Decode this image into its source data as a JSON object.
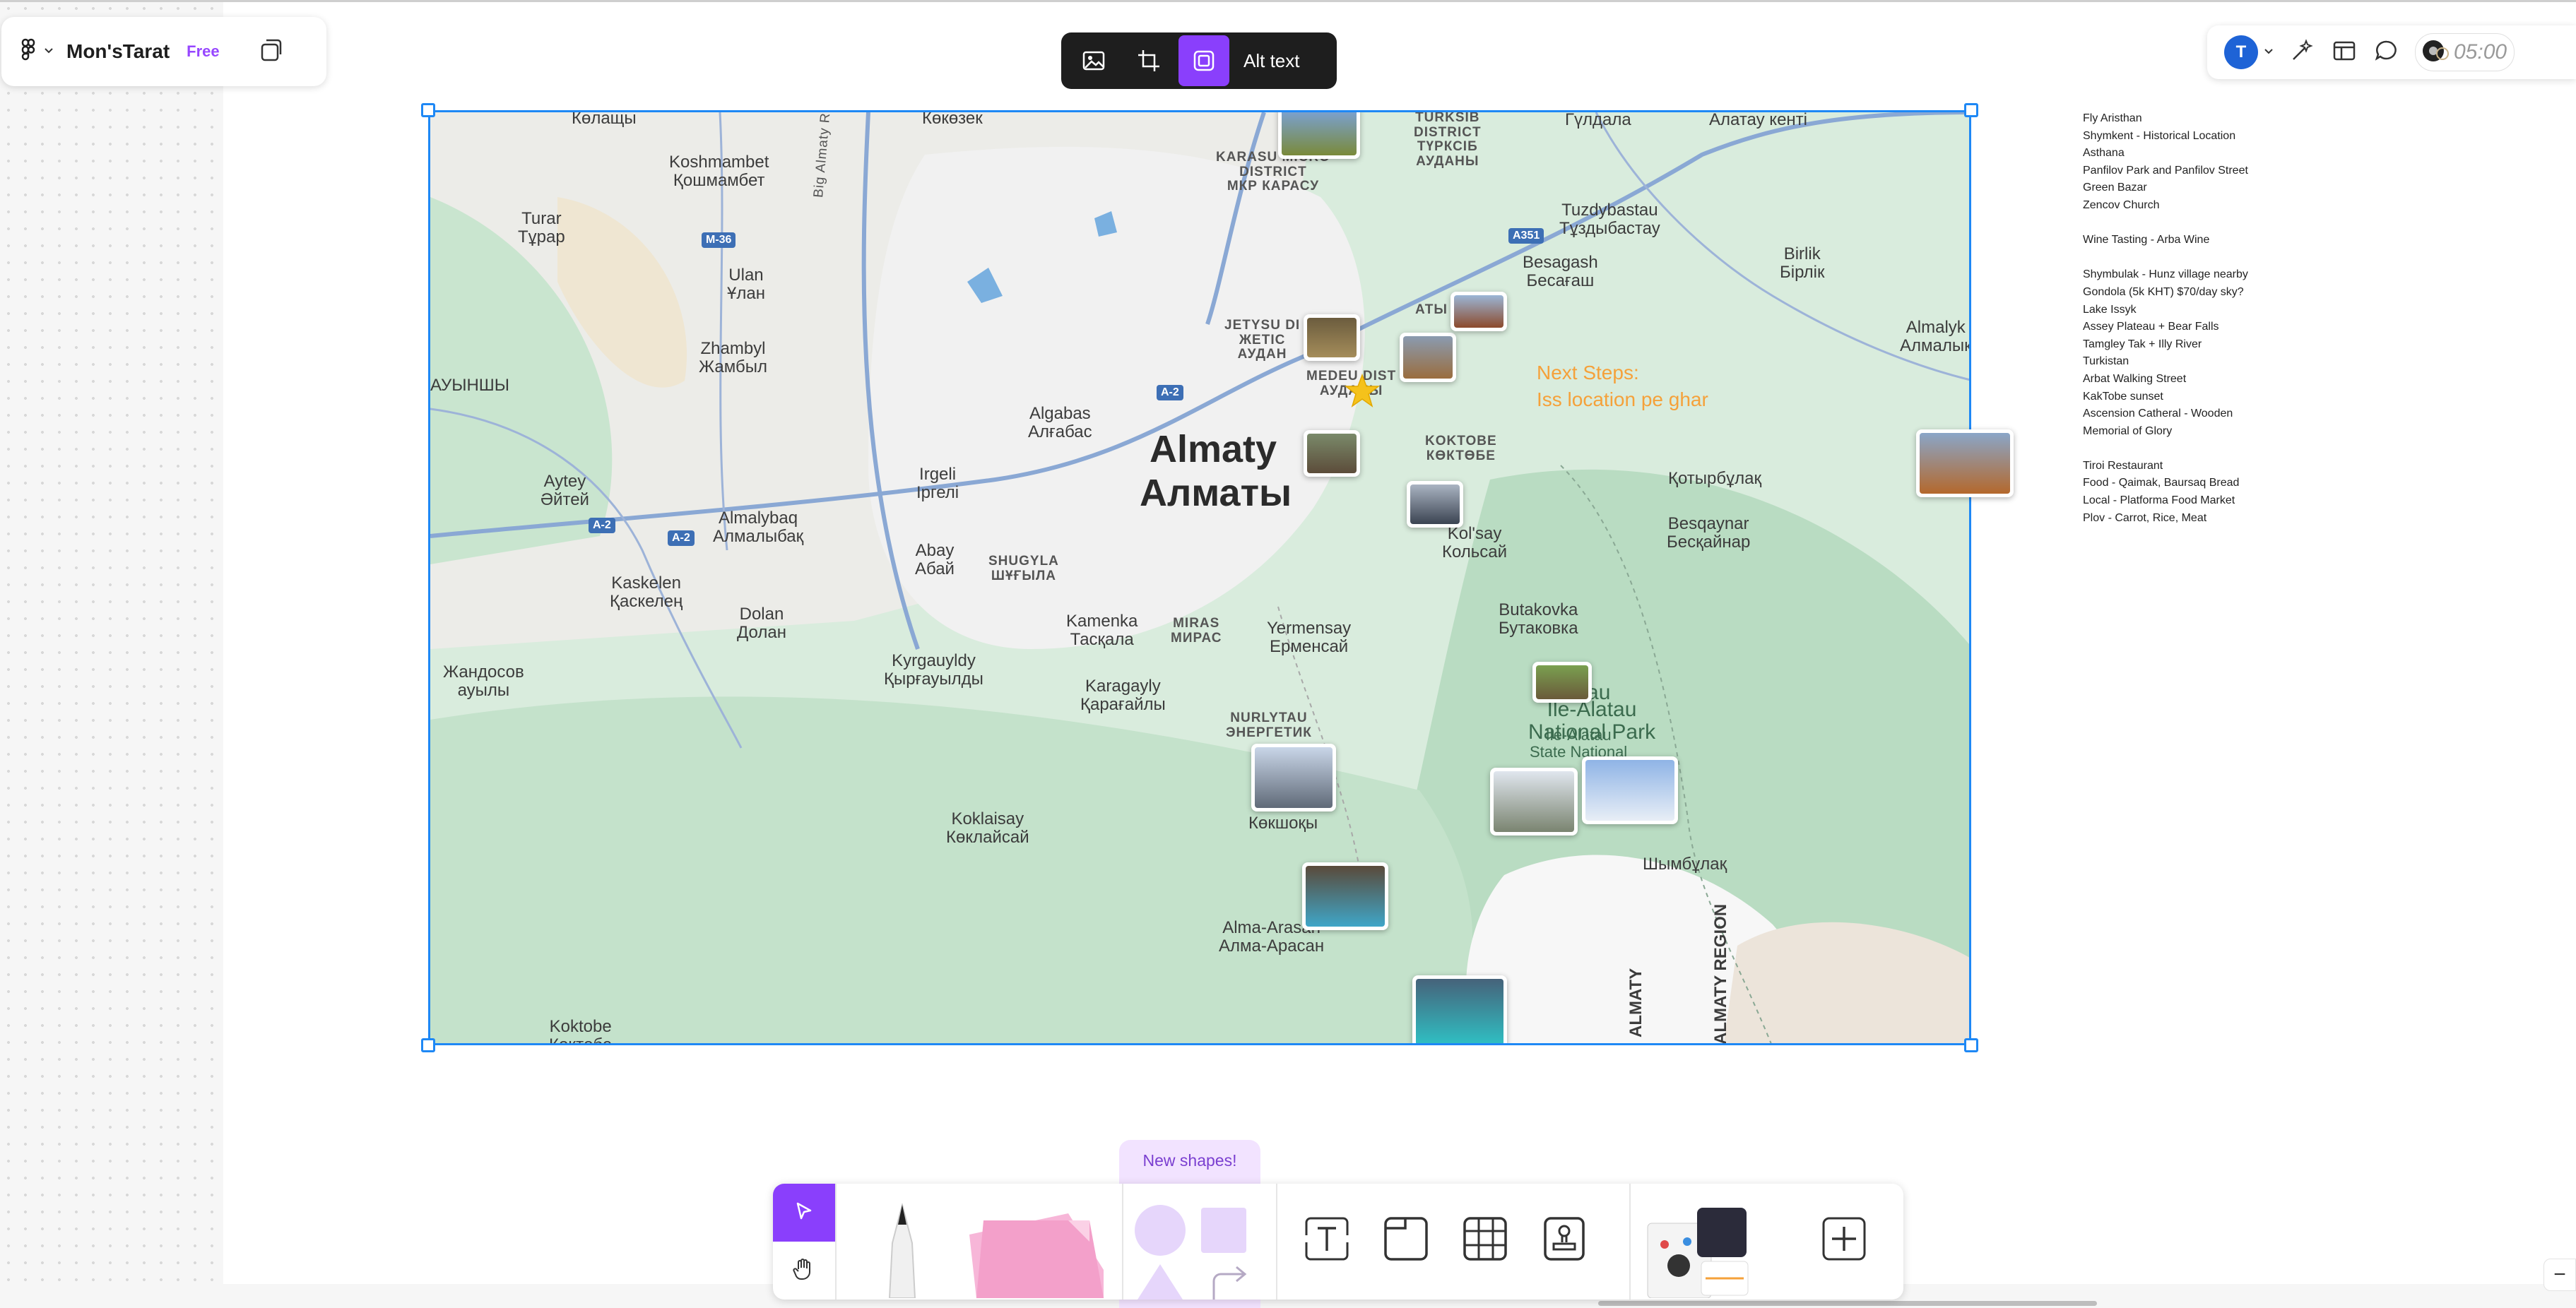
{
  "file": {
    "name": "Mon'sTarat",
    "plan": "Free"
  },
  "image_toolbar": {
    "alt_text_label": "Alt text"
  },
  "right_toolbar": {
    "avatar_initial": "T",
    "timer": "05:00"
  },
  "map": {
    "city_latin": "Almaty",
    "city_cyrillic": "Алматы",
    "labels": [
      "Көлащы",
      "Көкөзек",
      "Koshmambet\nҚошмамбет",
      "Turar\nТұрар",
      "Ulan\nҰлан",
      "Zhambyl\nЖамбыл",
      "АУЫНШЫ",
      "Aytey\nӘйтей",
      "Almalybaq\nАлмалыбақ",
      "Kaskelen\nҚаскелең",
      "Dolan\nДолан",
      "Жандосов\nауылы",
      "Algabas\nАлғабас",
      "Irgeli\nІргелі",
      "Abay\nАбай",
      "Kyrgauyldy\nҚырғауылды",
      "Kamenka\nТасқала",
      "Karagayly\nҚарағайлы",
      "Yermensay\nЕрменсай",
      "Kol'say\nКольсай",
      "Butakovka\nБутаковка",
      "Қотырбұлақ",
      "Besqaynar\nБесқайнар",
      "Tuzdybastau\nТұздыбастау",
      "Besagash\nБесағаш",
      "Birlik\nБірлік",
      "Almalyk\nАлмалык",
      "Алатау кенті",
      "Гүлдала",
      "Koklaisay\nКөклайсай",
      "Көкшоқы",
      "Alma-Arasan\nАлма-Арасан",
      "Шымбұлақ",
      "Koktobe\nКөктөбе",
      "Big Almaty Ring Rd",
      "ALMATY",
      "ALMATY REGION",
      "Ile-Alatau\nState National",
      "NURLYTAU\nЭНЕРГЕТИК",
      "MIRAS\nМИРАС",
      "SHUGYLA\nШҰҒЫЛА",
      "KOKTOBE\nКӨКТӨБЕ",
      "JETYSU DI\nЖЕТІС\nАУДАН",
      "MEDEU DIST\nАУДАНЫ",
      "TURKSIB\nDISTRICT\nТҮРКСІБ\nАУДАНЫ",
      "KARASU MICRO\nDISTRICT\nМКР КАРАСУ",
      "АТЫ"
    ],
    "shields": [
      "M-36",
      "A-2",
      "A-2",
      "A-2",
      "A351"
    ],
    "national_park": "Ile-Alatau\nNational Park",
    "national_park_prefix": "atau",
    "next_steps_title": "Next Steps:",
    "next_steps_body": "Iss location pe ghar"
  },
  "notes": [
    "Fly Aristhan",
    "Shymkent - Historical Location",
    "Asthana",
    "Panfilov Park and Panfilov Street",
    "Green Bazar",
    "Zencov Church",
    "",
    "Wine Tasting - Arba Wine",
    "",
    "Shymbulak - Hunz village nearby",
    "Gondola (5k KHT) $70/day sky?",
    "Lake Issyk",
    "Assey Plateau + Bear Falls",
    "Tamgley Tak + Illy River",
    "Turkistan",
    "Arbat Walking Street",
    "KakTobe sunset",
    "Ascension Catheral - Wooden",
    "Memorial of Glory",
    "",
    "Tiroi Restaurant",
    "Food - Qaimak, Baursaq Bread",
    "Local - Platforma Food Market",
    "Plov - Carrot, Rice, Meat"
  ],
  "bottom_toolbar": {
    "new_shapes_label": "New shapes!"
  },
  "icons": [
    "figma-logo-icon",
    "chevron-down-icon",
    "pages-icon",
    "image-icon",
    "crop-icon",
    "frame-icon",
    "ai-icon",
    "layout-icon",
    "comment-icon",
    "move-icon",
    "hand-icon",
    "pen-icon",
    "sticky-note-icon",
    "circle-shape-icon",
    "square-shape-icon",
    "triangle-shape-icon",
    "connector-icon",
    "text-icon",
    "section-icon",
    "table-icon",
    "stamp-icon",
    "widget-icon",
    "plus-icon",
    "minus-icon"
  ],
  "colors": {
    "accent_purple": "#8a3ffc",
    "selection_blue": "#1e88f5",
    "next_steps_orange": "#f5a13a"
  }
}
